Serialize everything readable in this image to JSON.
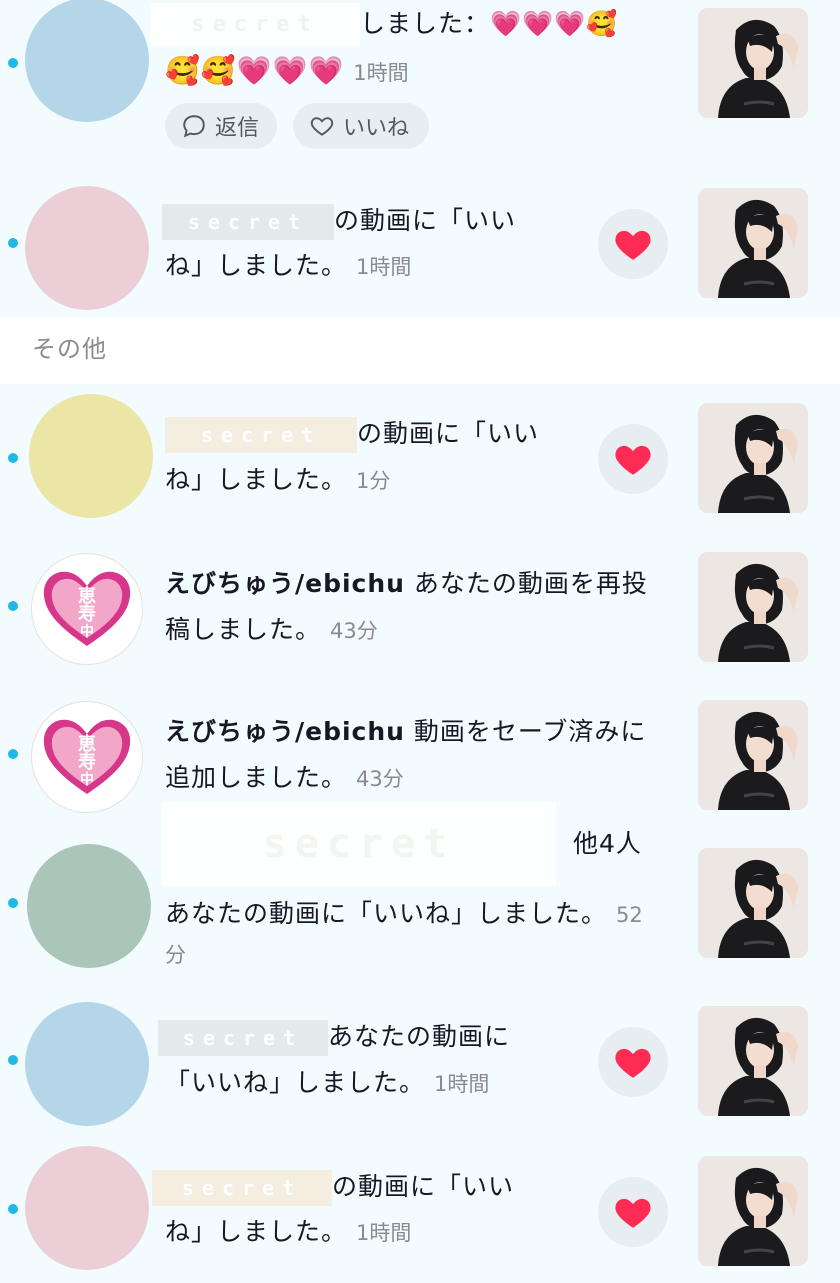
{
  "notifications_top": [
    {
      "id": "n1",
      "redacted_label": "secret",
      "text_line1": "しました：💗💗💗🥰",
      "text_line2_emojis": "🥰🥰💗💗💗",
      "time": "1時間",
      "reply_label": "返信",
      "like_label": "いいね",
      "avatar_color": "#b5d6e8"
    },
    {
      "id": "n2",
      "redacted_label": "secret",
      "text_line1": "の動画に「いい",
      "text_line2": "ね」しました。",
      "time": "1時間",
      "avatar_color": "#eccfd6"
    }
  ],
  "section": {
    "title": "その他"
  },
  "notifications_other": [
    {
      "id": "n3",
      "redacted_label": "secret",
      "text_line1": "の動画に「いい",
      "text_line2": "ね」しました。",
      "time": "1分",
      "avatar_color": "#ebe5a6"
    },
    {
      "id": "n4",
      "username": "えびちゅう/ebichu",
      "text_line1": " あなたの動画を再投",
      "text_line2": "稿しました。",
      "time": "43分",
      "avatar_text": "恵\n寿\n中"
    },
    {
      "id": "n5",
      "username": "えびちゅう/ebichu",
      "text_line1": " 動画をセーブ済みに",
      "text_line2": "追加しました。",
      "time": "43分",
      "avatar_text": "恵\n寿\n中"
    },
    {
      "id": "n6",
      "redacted_label": "secret",
      "others": "他4人",
      "text_line2": "あなたの動画に「いいね」しました。",
      "time_part1": "52",
      "time_part2": "分",
      "avatar_color": "#a9c6b9"
    },
    {
      "id": "n7",
      "redacted_label": "secret",
      "text_line1": "あなたの動画に",
      "text_line2": "「いいね」しました。",
      "time": "1時間",
      "avatar_color": "#b5d6e8"
    },
    {
      "id": "n8",
      "redacted_label": "secret",
      "text_line1": "の動画に「いい",
      "text_line2": "ね」しました。",
      "time": "1時間",
      "avatar_color": "#eccfd6"
    }
  ],
  "colors": {
    "background": "#f2fbfd",
    "unread_dot": "#20b8e6",
    "heart": "#fe2c55",
    "ebichu_heart": "#d6378a"
  },
  "icons": {
    "reply": "speech-bubble-icon",
    "like": "heart-outline-icon",
    "liked": "heart-filled-icon",
    "ebichu_avatar": "heart-logo"
  }
}
